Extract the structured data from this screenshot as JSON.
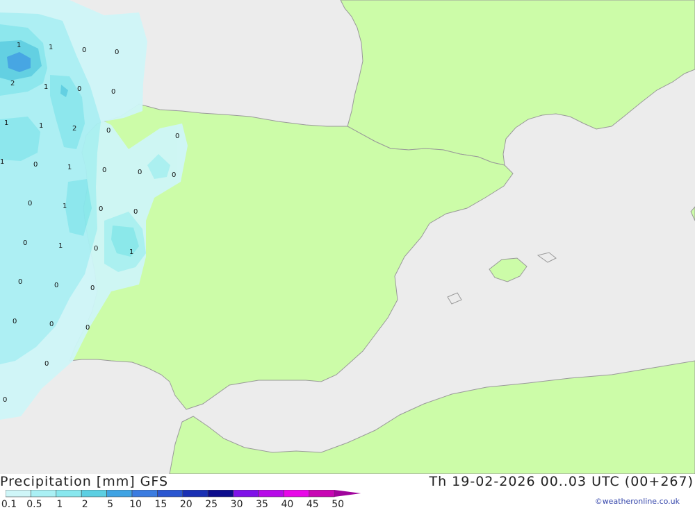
{
  "title": "Precipitation [mm] GFS",
  "datetime": "Th 19-02-2026 00..03 UTC (00+267)",
  "credit": "©weatheronline.co.uk",
  "colors": {
    "sea": "#ececec",
    "land": "#ccfca8",
    "coast": "#999999",
    "precip": [
      "#cff6f8",
      "#aaf0f4",
      "#88e7ee",
      "#5ccfe2",
      "#3fa3e3",
      "#3b7ce0",
      "#2a56d0",
      "#1a30b4",
      "#0c0c8c",
      "#7f12e8",
      "#b70ae8",
      "#e807e8",
      "#c806b4",
      "#a0049c"
    ]
  },
  "legend": {
    "ticks": [
      "0.1",
      "0.5",
      "1",
      "2",
      "5",
      "10",
      "15",
      "20",
      "25",
      "30",
      "35",
      "40",
      "45",
      "50"
    ]
  },
  "map_labels": [
    {
      "text": "1"
    },
    {
      "text": "1"
    },
    {
      "text": "0"
    },
    {
      "text": "0"
    },
    {
      "text": "2"
    },
    {
      "text": "1"
    },
    {
      "text": "0"
    },
    {
      "text": "0"
    },
    {
      "text": "1"
    },
    {
      "text": "1"
    },
    {
      "text": "2"
    },
    {
      "text": "0"
    },
    {
      "text": "0"
    },
    {
      "text": "1"
    },
    {
      "text": "0"
    },
    {
      "text": "1"
    },
    {
      "text": "0"
    },
    {
      "text": "0"
    },
    {
      "text": "0"
    },
    {
      "text": "0"
    },
    {
      "text": "1"
    },
    {
      "text": "0"
    },
    {
      "text": "0"
    },
    {
      "text": "0"
    },
    {
      "text": "1"
    },
    {
      "text": "0"
    },
    {
      "text": "1"
    },
    {
      "text": "0"
    },
    {
      "text": "0"
    },
    {
      "text": "0"
    },
    {
      "text": "0"
    },
    {
      "text": "0"
    },
    {
      "text": "0"
    },
    {
      "text": "0"
    },
    {
      "text": "0"
    }
  ]
}
